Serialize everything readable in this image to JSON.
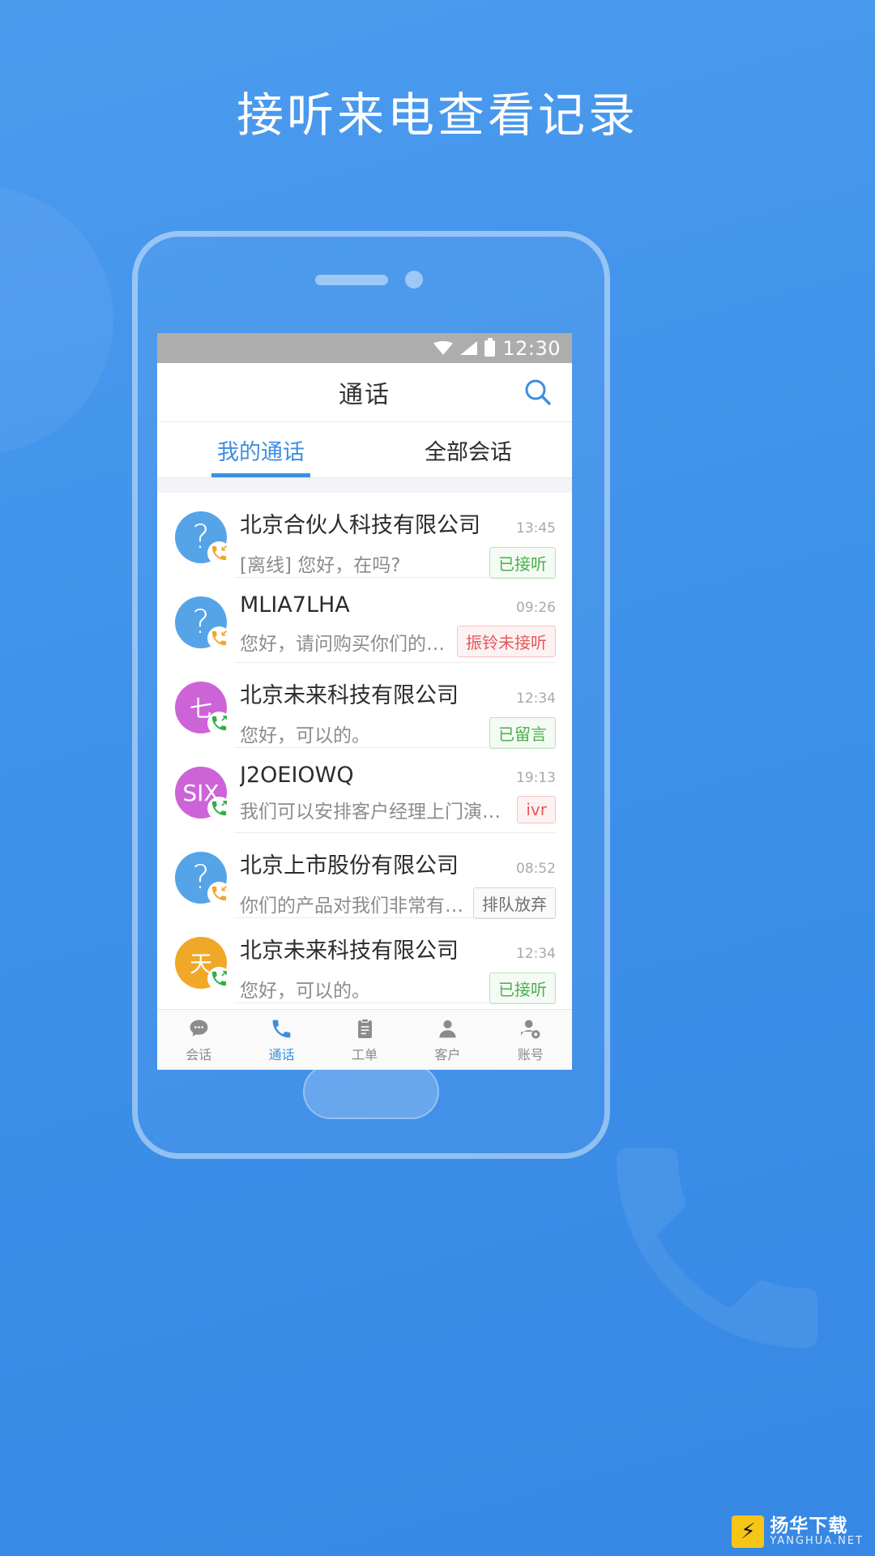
{
  "headline": "接听来电查看记录",
  "statusbar": {
    "time": "12:30",
    "icons": [
      "wifi-icon",
      "signal-icon",
      "battery-icon"
    ]
  },
  "titlebar": {
    "title": "通话",
    "search_icon": "search-icon"
  },
  "tabs": [
    {
      "label": "我的通话",
      "active": true
    },
    {
      "label": "全部会话",
      "active": false
    }
  ],
  "colors": {
    "brand_blue": "#3d8ee0",
    "page_bg": "#3d92e8",
    "avatar_blue": "#56a4e8",
    "avatar_purple": "#cc64d8",
    "avatar_orange": "#f0a828",
    "badge_green": "#4cae4c",
    "badge_red": "#e4595b",
    "badge_gray": "#6f6f6f"
  },
  "calls": [
    {
      "avatar_text": "?",
      "avatar_kind": "question",
      "avatar_color": "#56a4e8",
      "call_dir": "incoming",
      "name": "北京合伙人科技有限公司",
      "subtitle": "[离线] 您好，在吗?",
      "time": "13:45",
      "badge": "已接听",
      "badge_kind": "green"
    },
    {
      "avatar_text": "?",
      "avatar_kind": "question",
      "avatar_color": "#56a4e8",
      "call_dir": "incoming",
      "name": "MLIA7LHA",
      "subtitle": "您好，请问购买你们的服务前可...",
      "time": "09:26",
      "badge": "振铃未接听",
      "badge_kind": "red"
    },
    {
      "avatar_text": "七",
      "avatar_kind": "text",
      "avatar_color": "#cc64d8",
      "call_dir": "outgoing",
      "name": "北京未来科技有限公司",
      "subtitle": "您好，可以的。",
      "time": "12:34",
      "badge": "已留言",
      "badge_kind": "green"
    },
    {
      "avatar_text": "SIX",
      "avatar_kind": "text",
      "avatar_color": "#cc64d8",
      "call_dir": "outgoing",
      "name": "J2OEIOWQ",
      "subtitle": "我们可以安排客户经理上门演示。",
      "time": "19:13",
      "badge": "ivr",
      "badge_kind": "red"
    },
    {
      "avatar_text": "?",
      "avatar_kind": "question",
      "avatar_color": "#56a4e8",
      "call_dir": "incoming",
      "name": "北京上市股份有限公司",
      "subtitle": "你们的产品对我们非常有帮助。",
      "time": "08:52",
      "badge": "排队放弃",
      "badge_kind": "gray"
    },
    {
      "avatar_text": "天",
      "avatar_kind": "text",
      "avatar_color": "#f0a828",
      "call_dir": "outgoing",
      "name": "北京未来科技有限公司",
      "subtitle": "您好，可以的。",
      "time": "12:34",
      "badge": "已接听",
      "badge_kind": "green"
    }
  ],
  "bottomnav": [
    {
      "label": "会话",
      "icon": "chat-icon",
      "active": false
    },
    {
      "label": "通话",
      "icon": "phone-icon",
      "active": true
    },
    {
      "label": "工单",
      "icon": "clipboard-icon",
      "active": false
    },
    {
      "label": "客户",
      "icon": "person-icon",
      "active": false
    },
    {
      "label": "账号",
      "icon": "person-gear-icon",
      "active": false
    }
  ],
  "watermark": {
    "line1": "扬华下载",
    "line2": "YANGHUA.NET"
  }
}
